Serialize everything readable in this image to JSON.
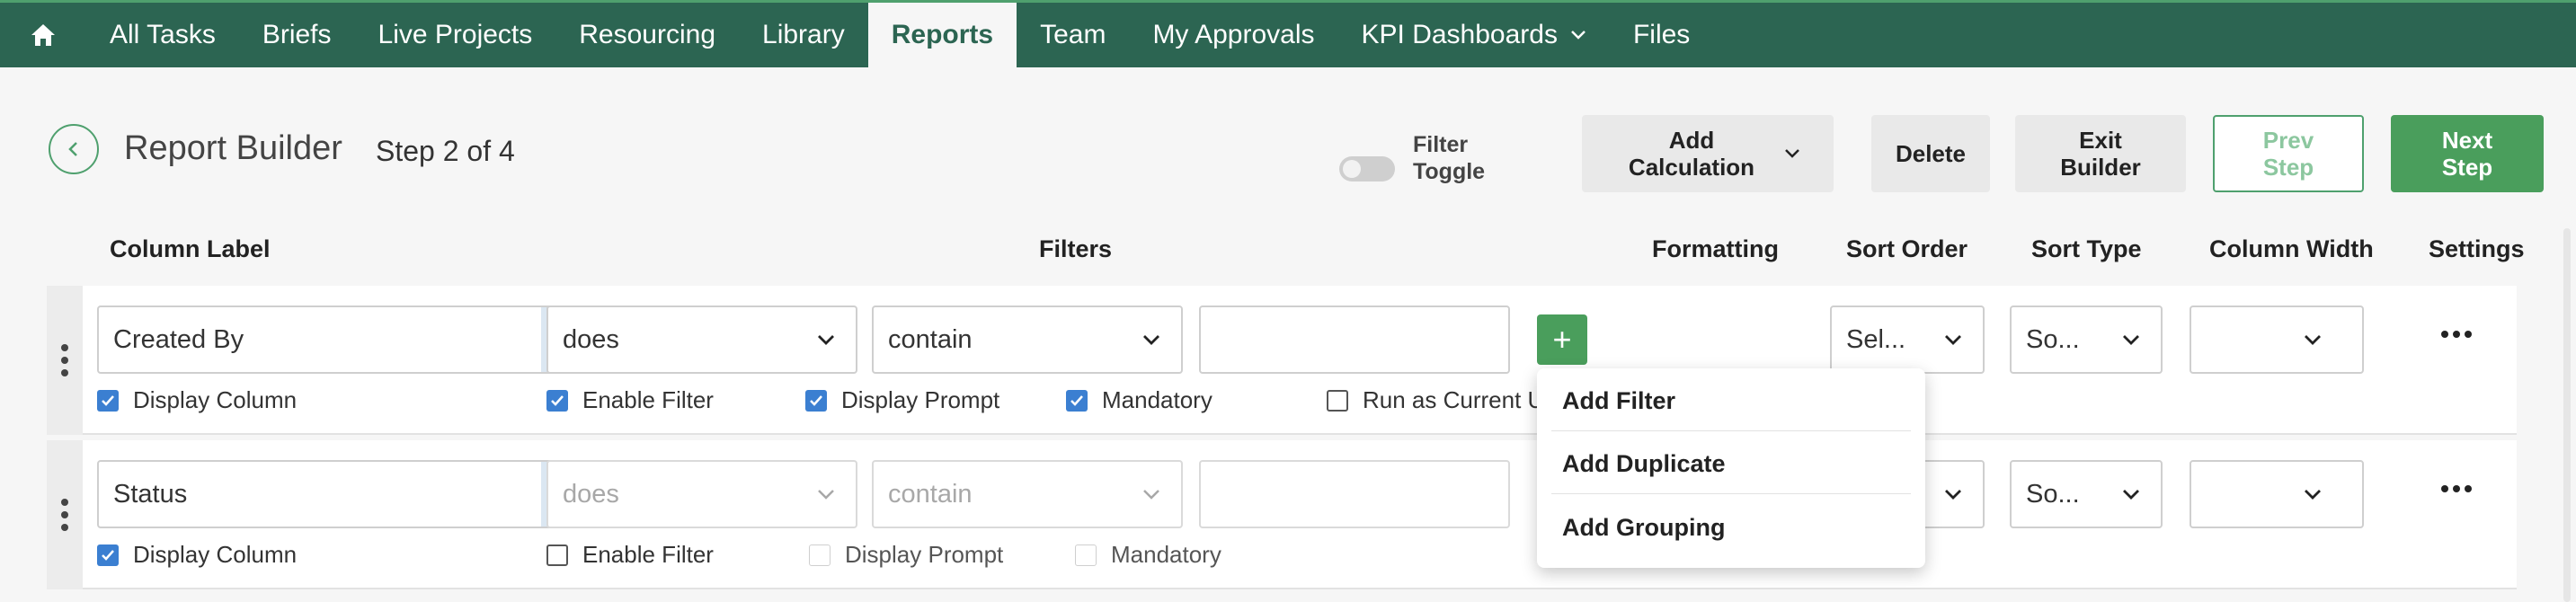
{
  "nav": {
    "items": [
      {
        "label": "All Tasks"
      },
      {
        "label": "Briefs"
      },
      {
        "label": "Live Projects"
      },
      {
        "label": "Resourcing"
      },
      {
        "label": "Library"
      },
      {
        "label": "Reports"
      },
      {
        "label": "Team"
      },
      {
        "label": "My Approvals"
      },
      {
        "label": "KPI Dashboards"
      },
      {
        "label": "Files"
      }
    ],
    "active": "Reports"
  },
  "header": {
    "title": "Report Builder",
    "step": "Step 2 of 4",
    "filter_toggle_label": "Filter Toggle",
    "add_calculation_label": "Add Calculation",
    "delete_label": "Delete",
    "exit_builder_label": "Exit Builder",
    "prev_step_label": "Prev Step",
    "next_step_label": "Next Step"
  },
  "columns": {
    "column_label": "Column Label",
    "filters": "Filters",
    "formatting": "Formatting",
    "sort_order": "Sort Order",
    "sort_type": "Sort Type",
    "column_width": "Column Width",
    "settings": "Settings"
  },
  "rows": [
    {
      "label": "Created By",
      "info": "i",
      "operator": "does",
      "condition": "contain",
      "value": "",
      "sort_order": "Sel...",
      "sort_type": "So...",
      "column_width": "",
      "checks": {
        "display_column": "Display Column",
        "enable_filter": "Enable Filter",
        "display_prompt": "Display Prompt",
        "mandatory": "Mandatory",
        "run_as_current_user": "Run as Current U"
      }
    },
    {
      "label": "Status",
      "info": "i",
      "operator": "does",
      "condition": "contain",
      "value": "",
      "sort_type": "So...",
      "column_width": "",
      "checks": {
        "display_column": "Display Column",
        "enable_filter": "Enable Filter",
        "display_prompt": "Display Prompt",
        "mandatory": "Mandatory"
      }
    }
  ],
  "add_menu": {
    "button_label": "+",
    "items": [
      {
        "label": "Add Filter"
      },
      {
        "label": "Add Duplicate"
      },
      {
        "label": "Add Grouping"
      }
    ]
  },
  "colors": {
    "nav_bg": "#2c6552",
    "accent_green": "#4a9e5c",
    "checkbox_blue": "#3b7fd1"
  }
}
